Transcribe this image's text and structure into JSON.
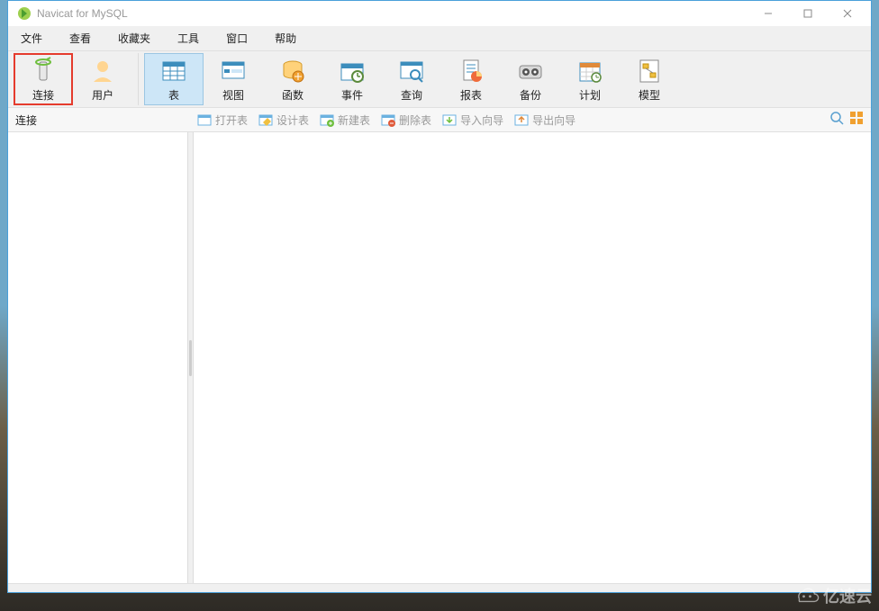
{
  "window": {
    "title": "Navicat for MySQL"
  },
  "menu": {
    "items": [
      "文件",
      "查看",
      "收藏夹",
      "工具",
      "窗口",
      "帮助"
    ]
  },
  "toolbar": {
    "group1": [
      {
        "name": "connect",
        "label": "连接",
        "highlighted": true
      },
      {
        "name": "user",
        "label": "用户"
      }
    ],
    "group2": [
      {
        "name": "table",
        "label": "表",
        "active": true
      },
      {
        "name": "view",
        "label": "视图"
      },
      {
        "name": "function",
        "label": "函数"
      },
      {
        "name": "event",
        "label": "事件"
      },
      {
        "name": "query",
        "label": "查询"
      },
      {
        "name": "report",
        "label": "报表"
      },
      {
        "name": "backup",
        "label": "备份"
      },
      {
        "name": "schedule",
        "label": "计划"
      },
      {
        "name": "model",
        "label": "模型"
      }
    ]
  },
  "subtoolbar": {
    "left_label": "连接",
    "actions": [
      {
        "name": "open-table",
        "label": "打开表"
      },
      {
        "name": "design-table",
        "label": "设计表"
      },
      {
        "name": "new-table",
        "label": "新建表"
      },
      {
        "name": "delete-table",
        "label": "删除表"
      },
      {
        "name": "import-wizard",
        "label": "导入向导"
      },
      {
        "name": "export-wizard",
        "label": "导出向导"
      }
    ]
  },
  "watermark": {
    "text": "亿速云"
  }
}
